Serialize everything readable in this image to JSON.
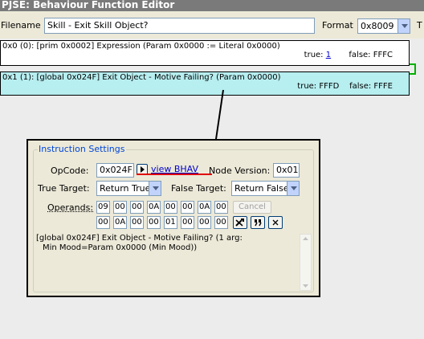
{
  "window": {
    "title": "PJSE: Behaviour Function Editor"
  },
  "header": {
    "filename_label": "Filename",
    "filename_value": "Skill - Exit Skill Object?",
    "format_label": "Format",
    "format_value": "0x8009",
    "trailing_label": "T"
  },
  "nodes": [
    {
      "description": "0x0 (0): [prim 0x0002] Expression (Param 0x0000 := Literal 0x0000)",
      "true_label": "true:",
      "true_value": "1",
      "false_label": "false:",
      "false_value": "FFFC"
    },
    {
      "description": "0x1 (1): [global 0x024F] Exit Object - Motive Failing? (Param 0x0000)",
      "true_label": "true:",
      "true_value": "FFFD",
      "false_label": "false:",
      "false_value": "FFFE"
    }
  ],
  "instruction": {
    "group_title": "Instruction Settings",
    "opcode_label": "OpCode:",
    "opcode_value": "0x024F",
    "view_bhav_label": "view BHAV",
    "node_version_label": "Node Version:",
    "node_version_value": "0x01",
    "true_target_label": "True Target:",
    "true_target_value": "Return True",
    "false_target_label": "False Target:",
    "false_target_value": "Return False",
    "operands_label": "Operands:",
    "operands_row1": [
      "09",
      "00",
      "00",
      "0A",
      "00",
      "00",
      "0A",
      "00"
    ],
    "operands_row2": [
      "00",
      "0A",
      "00",
      "00",
      "01",
      "00",
      "00",
      "00"
    ],
    "cancel_label": "Cancel",
    "description_line1": "[global 0x024F] Exit Object - Motive Failing? (1 arg:",
    "description_line2": "Min Mood=Param 0x0000 (Min Mood))"
  },
  "colors": {
    "titlebar": "#7a7a7a",
    "selected_node": "#b7eef0",
    "link": "#0000cc",
    "group_title": "#0046d5",
    "underline_annotation": "#e00000",
    "connector": "#00b000"
  },
  "icons": {
    "view_bhav": "play-arrow-icon",
    "tool_a": "wrench-icon",
    "tool_b": "quote-icon",
    "tool_c": "close-icon"
  }
}
